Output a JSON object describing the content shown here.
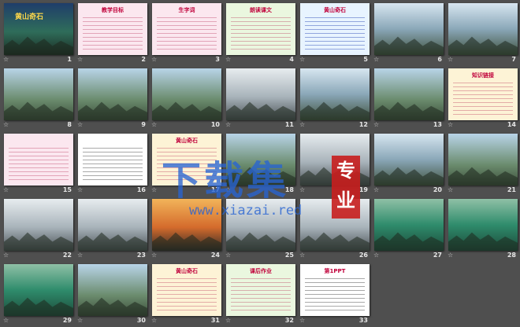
{
  "slides": [
    {
      "n": "1",
      "kind": "title",
      "title": "黄山奇石"
    },
    {
      "n": "2",
      "kind": "text-pink",
      "title": "教学目标"
    },
    {
      "n": "3",
      "kind": "text-pink",
      "title": "生字词"
    },
    {
      "n": "4",
      "kind": "text-green",
      "title": "朗读课文"
    },
    {
      "n": "5",
      "kind": "text-blue",
      "title": "黄山奇石"
    },
    {
      "n": "6",
      "kind": "pine"
    },
    {
      "n": "7",
      "kind": "pine"
    },
    {
      "n": "8",
      "kind": "landscape"
    },
    {
      "n": "9",
      "kind": "landscape"
    },
    {
      "n": "10",
      "kind": "landscape"
    },
    {
      "n": "11",
      "kind": "mist"
    },
    {
      "n": "12",
      "kind": "pine"
    },
    {
      "n": "13",
      "kind": "landscape"
    },
    {
      "n": "14",
      "kind": "text-cream",
      "title": "知识链接"
    },
    {
      "n": "15",
      "kind": "text-pink",
      "title": ""
    },
    {
      "n": "16",
      "kind": "text-plain",
      "title": ""
    },
    {
      "n": "17",
      "kind": "text-cream",
      "title": "黄山奇石"
    },
    {
      "n": "18",
      "kind": "landscape"
    },
    {
      "n": "19",
      "kind": "mist"
    },
    {
      "n": "20",
      "kind": "pine"
    },
    {
      "n": "21",
      "kind": "landscape"
    },
    {
      "n": "22",
      "kind": "mist"
    },
    {
      "n": "23",
      "kind": "mist"
    },
    {
      "n": "24",
      "kind": "sunset"
    },
    {
      "n": "25",
      "kind": "mist"
    },
    {
      "n": "26",
      "kind": "mist"
    },
    {
      "n": "27",
      "kind": "water"
    },
    {
      "n": "28",
      "kind": "water"
    },
    {
      "n": "29",
      "kind": "water"
    },
    {
      "n": "30",
      "kind": "landscape"
    },
    {
      "n": "31",
      "kind": "text-cream",
      "title": "黄山奇石"
    },
    {
      "n": "32",
      "kind": "text-green",
      "title": "课后作业"
    },
    {
      "n": "33",
      "kind": "text-plain",
      "title": "第1PPT"
    }
  ],
  "watermark": {
    "main": "下载集",
    "url": "www.xiazai.red",
    "badge": "专业"
  },
  "colors": {
    "background": "#4f4f4f",
    "selection": "#f7c843"
  }
}
